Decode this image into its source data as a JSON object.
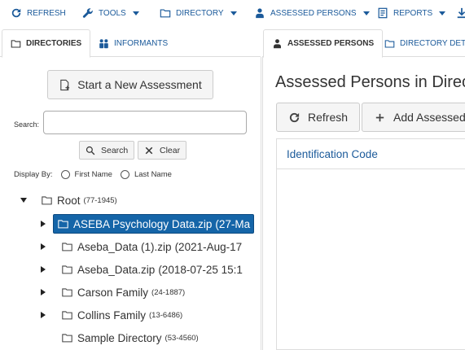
{
  "toolbar": {
    "refresh_label": "REFRESH",
    "tools_label": "TOOLS",
    "directory_label": "DIRECTORY",
    "assessed_persons_label": "ASSESSED PERSONS",
    "reports_label": "REPORTS"
  },
  "left_panel": {
    "tabs": [
      {
        "label": "DIRECTORIES",
        "active": true,
        "icon": "folder-icon"
      },
      {
        "label": "INFORMANTS",
        "active": false,
        "icon": "users-icon"
      }
    ],
    "new_assessment_label": "Start a New Assessment",
    "search": {
      "label": "Search:",
      "value": "",
      "placeholder": "",
      "search_button_label": "Search",
      "clear_button_label": "Clear"
    },
    "display_by": {
      "label": "Display By:",
      "options": [
        "First Name",
        "Last Name"
      ],
      "selected": null
    },
    "tree": {
      "root": {
        "name": "Root",
        "meta": "(77-1945)",
        "expanded": true
      },
      "children": [
        {
          "name": "ASEBA Psychology Data.zip",
          "date": "(27-Ma",
          "meta": "",
          "selected": true,
          "has_children": true
        },
        {
          "name": "Aseba_Data (1).zip",
          "date": "(2021-Aug-17",
          "meta": "",
          "selected": false,
          "has_children": true
        },
        {
          "name": "Aseba_Data.zip",
          "date": "(2018-07-25 15:1",
          "meta": "",
          "selected": false,
          "has_children": true
        },
        {
          "name": "Carson Family",
          "date": "",
          "meta": "(24-1887)",
          "selected": false,
          "has_children": true
        },
        {
          "name": "Collins Family",
          "date": "",
          "meta": "(13-6486)",
          "selected": false,
          "has_children": true
        },
        {
          "name": "Sample Directory",
          "date": "",
          "meta": "(53-4560)",
          "selected": false,
          "has_children": false
        }
      ]
    }
  },
  "right_panel": {
    "tabs": [
      {
        "label": "ASSESSED PERSONS",
        "active": true,
        "icon": "person-icon"
      },
      {
        "label": "DIRECTORY DETA",
        "active": false,
        "icon": "folder-icon"
      }
    ],
    "title": "Assessed Persons in Direc",
    "refresh_button_label": "Refresh",
    "add_button_label": "Add Assessed",
    "grid": {
      "columns": [
        "Identification Code"
      ],
      "rows": []
    }
  },
  "colors": {
    "link_blue": "#1b5a9a",
    "selected_bg": "#1565a8",
    "border": "#dddddd"
  }
}
